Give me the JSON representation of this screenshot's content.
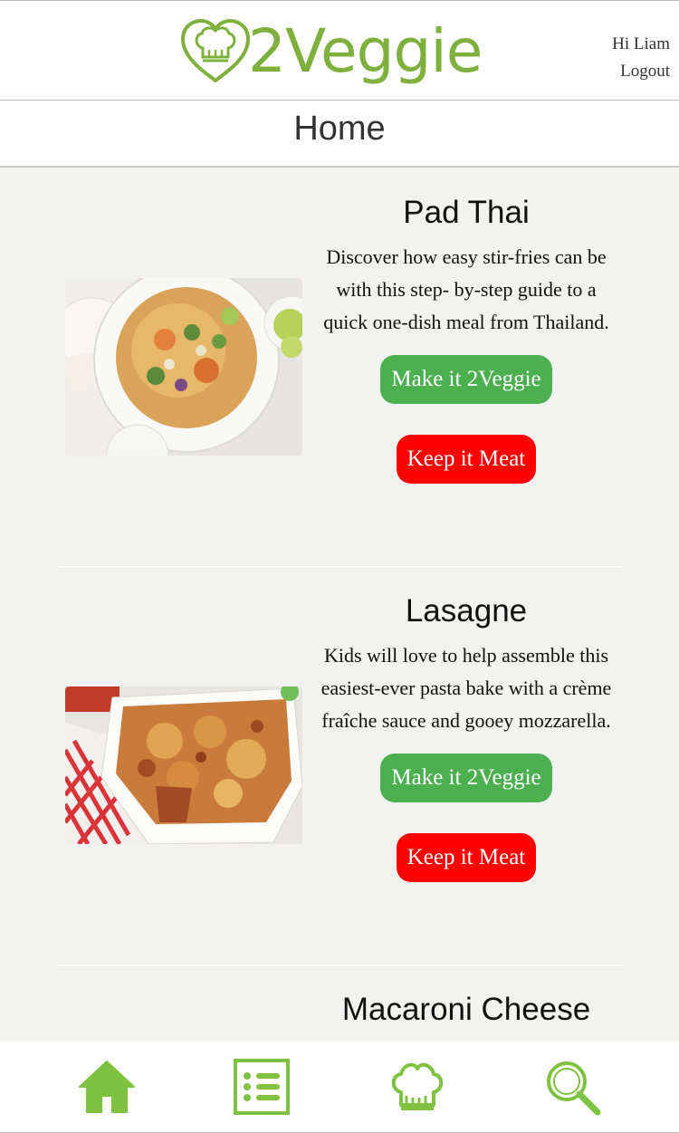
{
  "header": {
    "logo_text": "2Veggie",
    "greeting": "Hi Liam",
    "logout": "Logout",
    "brand_color": "#7fb03e"
  },
  "page": {
    "title": "Home"
  },
  "recipes": [
    {
      "title": "Pad Thai",
      "description": "Discover how easy stir-fries can be with this step- by-step guide to a quick one-dish meal from Thailand.",
      "veggie_label": "Make it 2Veggie",
      "meat_label": "Keep it Meat"
    },
    {
      "title": "Lasagne",
      "description": "Kids will love to help assemble this easiest-ever pasta bake with a crème fraîche sauce and gooey mozzarella.",
      "veggie_label": "Make it 2Veggie",
      "meat_label": "Keep it Meat"
    },
    {
      "title": "Macaroni Cheese"
    }
  ],
  "nav": {
    "items": [
      "home-icon",
      "list-icon",
      "chef-hat-icon",
      "search-icon"
    ],
    "color": "#7fc241"
  },
  "colors": {
    "veggie_button": "#4caf50",
    "meat_button": "#fe0000",
    "background": "#f2f2f0"
  }
}
